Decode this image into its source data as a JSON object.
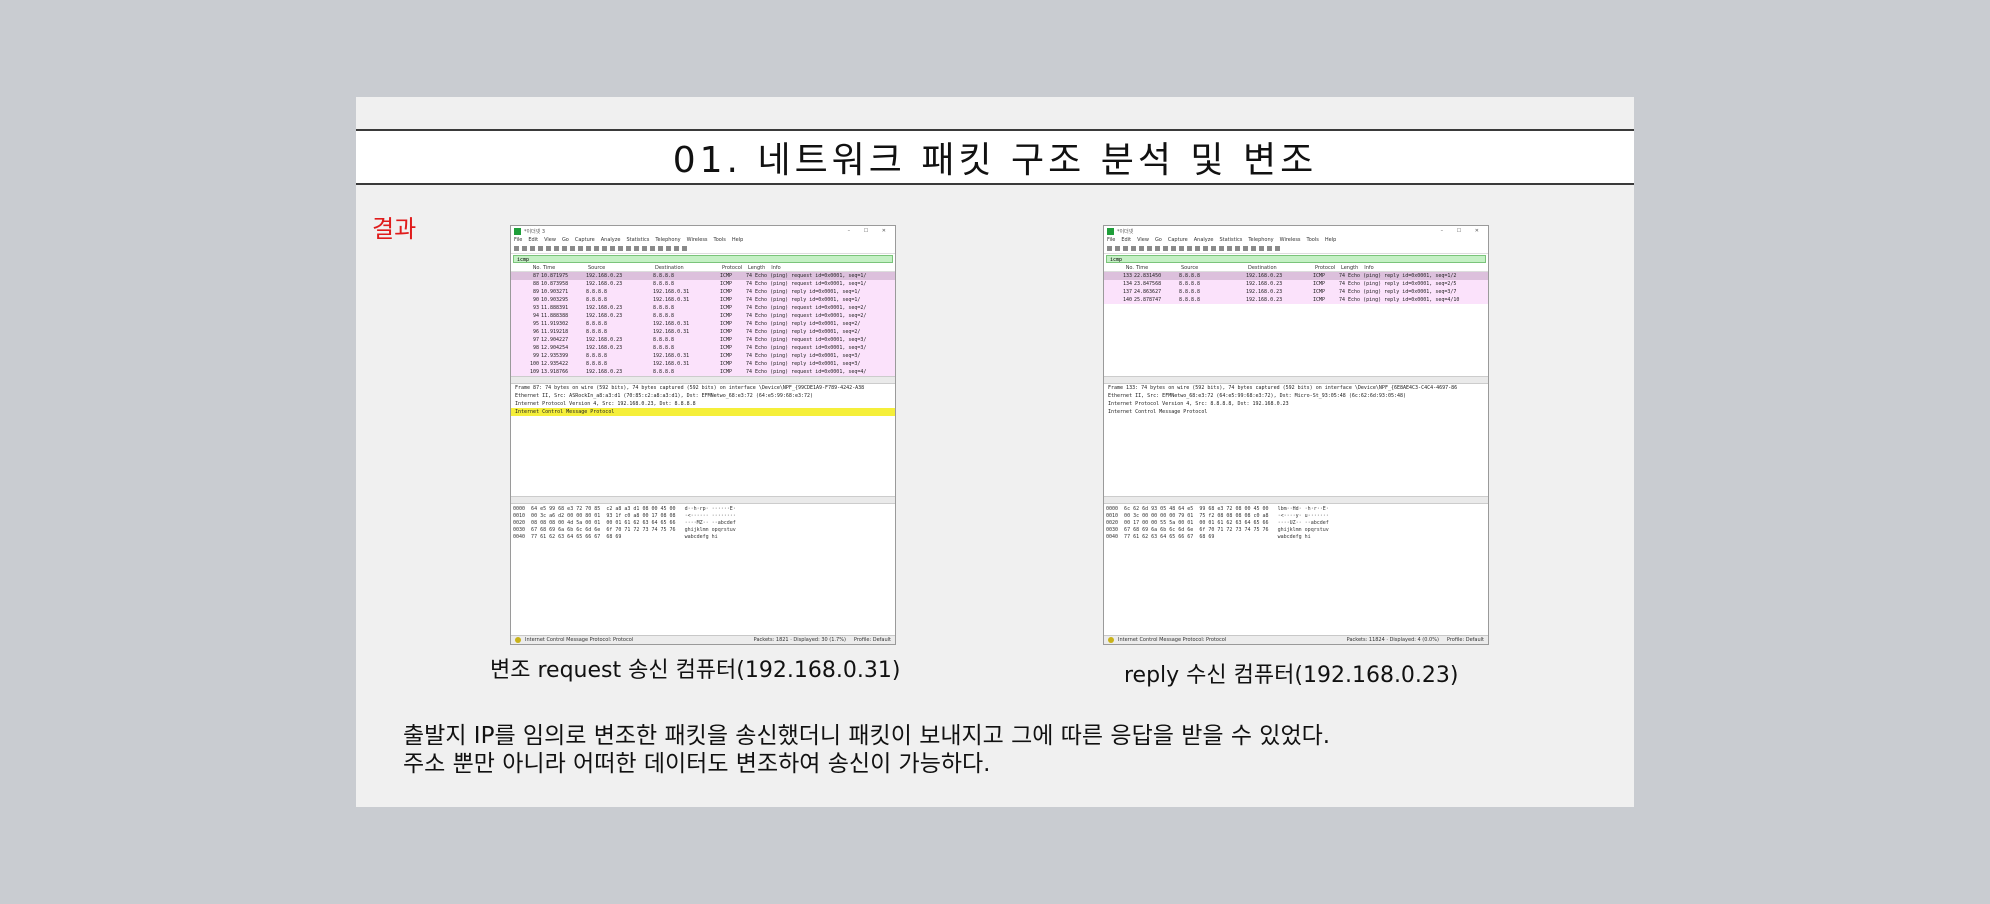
{
  "slide": {
    "title": "01. 네트워크 패킷 구조 분석 및 변조",
    "result_label": "결과",
    "body_lines": [
      "출발지 IP를 임의로 변조한 패킷을 송신했더니 패킷이 보내지고 그에 따른 응답을 받을 수 있었다.",
      "주소 뿐만 아니라 어떠한 데이터도 변조하여 송신이 가능하다."
    ]
  },
  "left_capture": {
    "caption": "변조 request 송신 컴퓨터(192.168.0.31)",
    "window_title": "*이더넷 3",
    "menu": [
      "File",
      "Edit",
      "View",
      "Go",
      "Capture",
      "Analyze",
      "Statistics",
      "Telephony",
      "Wireless",
      "Tools",
      "Help"
    ],
    "filter": "icmp",
    "columns": [
      "No.",
      "Time",
      "Source",
      "Destination",
      "Protocol",
      "Length",
      "Info"
    ],
    "rows": [
      [
        "87",
        "10.871975",
        "192.168.0.23",
        "8.8.8.8",
        "ICMP",
        "74 Echo (ping) request  id=0x0001, seq=1/"
      ],
      [
        "88",
        "10.873958",
        "192.168.0.23",
        "8.8.8.8",
        "ICMP",
        "74 Echo (ping) request  id=0x0001, seq=1/"
      ],
      [
        "89",
        "10.903271",
        "8.8.8.8",
        "192.168.0.31",
        "ICMP",
        "74 Echo (ping) reply    id=0x0001, seq=1/"
      ],
      [
        "90",
        "10.903295",
        "8.8.8.8",
        "192.168.0.31",
        "ICMP",
        "74 Echo (ping) reply    id=0x0001, seq=1/"
      ],
      [
        "93",
        "11.888391",
        "192.168.0.23",
        "8.8.8.8",
        "ICMP",
        "74 Echo (ping) request  id=0x0001, seq=2/"
      ],
      [
        "94",
        "11.888388",
        "192.168.0.23",
        "8.8.8.8",
        "ICMP",
        "74 Echo (ping) request  id=0x0001, seq=2/"
      ],
      [
        "95",
        "11.919302",
        "8.8.8.8",
        "192.168.0.31",
        "ICMP",
        "74 Echo (ping) reply    id=0x0001, seq=2/"
      ],
      [
        "96",
        "11.919218",
        "8.8.8.8",
        "192.168.0.31",
        "ICMP",
        "74 Echo (ping) reply    id=0x0001, seq=2/"
      ],
      [
        "97",
        "12.904227",
        "192.168.0.23",
        "8.8.8.8",
        "ICMP",
        "74 Echo (ping) request  id=0x0001, seq=3/"
      ],
      [
        "98",
        "12.904254",
        "192.168.0.23",
        "8.8.8.8",
        "ICMP",
        "74 Echo (ping) request  id=0x0001, seq=3/"
      ],
      [
        "99",
        "12.935399",
        "8.8.8.8",
        "192.168.0.31",
        "ICMP",
        "74 Echo (ping) reply    id=0x0001, seq=3/"
      ],
      [
        "100",
        "12.935422",
        "8.8.8.8",
        "192.168.0.31",
        "ICMP",
        "74 Echo (ping) reply    id=0x0001, seq=3/"
      ],
      [
        "109",
        "13.918766",
        "192.168.0.23",
        "8.8.8.8",
        "ICMP",
        "74 Echo (ping) request  id=0x0001, seq=4/"
      ]
    ],
    "details": [
      "Frame 87: 74 bytes on wire (592 bits), 74 bytes captured (592 bits) on interface \\Device\\NPF_{99CDE1A9-F789-4242-A38",
      "Ethernet II, Src: ASRockIn_a8:a3:d1 (70:85:c2:a8:a3:d1), Dst: EFMNetwo_68:e3:72 (64:e5:99:68:e3:72)",
      "Internet Protocol Version 4, Src: 192.168.0.23, Dst: 8.8.8.8",
      "Internet Control Message Protocol"
    ],
    "hex": [
      "0000  64 e5 99 68 e3 72 70 85  c2 a8 a3 d1 08 00 45 00   d··h·rp· ······E·",
      "0010  00 3c a6 d2 00 00 80 01  93 1f c0 a8 00 17 08 08   ·<······ ········",
      "0020  08 08 08 00 4d 5a 00 01  00 01 61 62 63 64 65 66   ····MZ·· ··abcdef",
      "0030  67 68 69 6a 6b 6c 6d 6e  6f 70 71 72 73 74 75 76   ghijklmn opqrstuv",
      "0040  77 61 62 63 64 65 66 67  68 69                     wabcdefg hi"
    ],
    "status_left": "Internet Control Message Protocol: Protocol",
    "status_packets": "Packets: 1821 · Displayed: 30 (1.7%)",
    "status_profile": "Profile: Default"
  },
  "right_capture": {
    "caption": "reply 수신 컴퓨터(192.168.0.23)",
    "window_title": "*이더넷",
    "menu": [
      "File",
      "Edit",
      "View",
      "Go",
      "Capture",
      "Analyze",
      "Statistics",
      "Telephony",
      "Wireless",
      "Tools",
      "Help"
    ],
    "filter": "icmp",
    "columns": [
      "No.",
      "Time",
      "Source",
      "Destination",
      "Protocol",
      "Length",
      "Info"
    ],
    "rows": [
      [
        "133",
        "22.831450",
        "8.8.8.8",
        "192.168.0.23",
        "ICMP",
        "74 Echo (ping) reply    id=0x0001, seq=1/2"
      ],
      [
        "134",
        "23.847568",
        "8.8.8.8",
        "192.168.0.23",
        "ICMP",
        "74 Echo (ping) reply    id=0x0001, seq=2/5"
      ],
      [
        "137",
        "24.863627",
        "8.8.8.8",
        "192.168.0.23",
        "ICMP",
        "74 Echo (ping) reply    id=0x0001, seq=3/7"
      ],
      [
        "140",
        "25.878747",
        "8.8.8.8",
        "192.168.0.23",
        "ICMP",
        "74 Echo (ping) reply    id=0x0001, seq=4/10"
      ]
    ],
    "details": [
      "Frame 133: 74 bytes on wire (592 bits), 74 bytes captured (592 bits) on interface \\Device\\NPF_{6E8AE4C3-C4C4-4697-86",
      "Ethernet II, Src: EFMNetwo_68:e3:72 (64:e5:99:68:e3:72), Dst: Micro-St_93:05:48 (6c:62:6d:93:05:48)",
      "Internet Protocol Version 4, Src: 8.8.8.8, Dst: 192.168.0.23",
      "Internet Control Message Protocol"
    ],
    "hex": [
      "0000  6c 62 6d 93 05 48 64 e5  99 68 e3 72 08 00 45 00   lbm··Hd· ·h·r··E·",
      "0010  00 3c 00 00 00 00 79 01  75 f2 08 08 08 08 c0 a8   ·<····y· u·······",
      "0020  00 17 00 00 55 5a 00 01  00 01 61 62 63 64 65 66   ····UZ·· ··abcdef",
      "0030  67 68 69 6a 6b 6c 6d 6e  6f 70 71 72 73 74 75 76   ghijklmn opqrstuv",
      "0040  77 61 62 63 64 65 66 67  68 69                     wabcdefg hi"
    ],
    "status_left": "Internet Control Message Protocol: Protocol",
    "status_packets": "Packets: 11824 · Displayed: 4 (0.0%)",
    "status_profile": "Profile: Default"
  }
}
